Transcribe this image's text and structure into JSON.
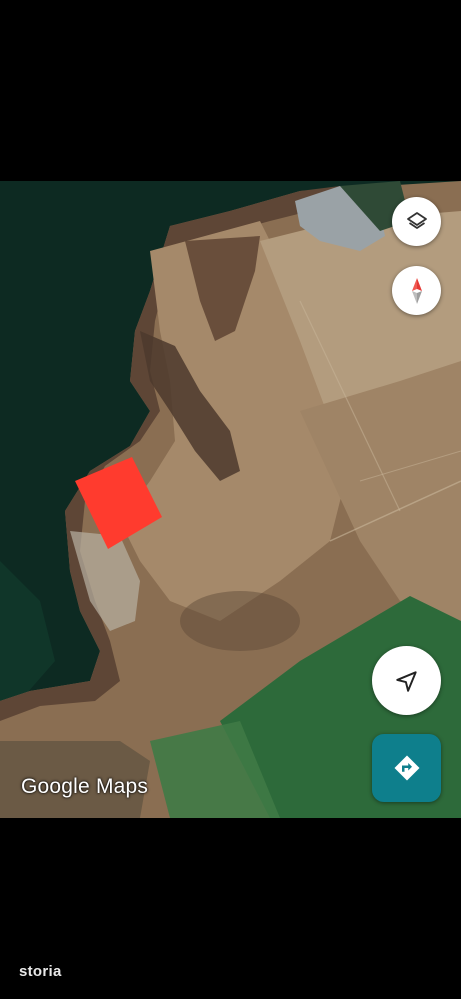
{
  "map": {
    "attribution": "Google Maps",
    "view": "satellite",
    "highlight_color": "#ff3b2e",
    "controls": {
      "layers_icon": "layers-icon",
      "compass_icon": "compass-icon",
      "locate_icon": "navigation-arrow-icon",
      "directions_icon": "directions-icon",
      "directions_color": "#0e7f8c"
    }
  },
  "watermark": {
    "text": "storia"
  }
}
